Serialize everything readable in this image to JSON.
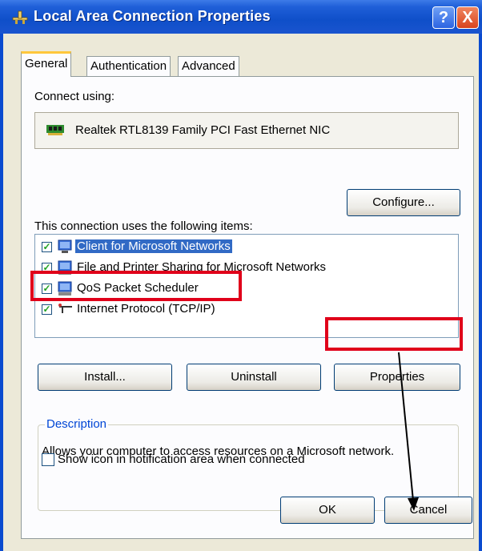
{
  "window": {
    "title": "Local Area Connection Properties",
    "help_glyph": "?",
    "close_glyph": "X"
  },
  "tabs": [
    {
      "label": "General",
      "selected": true
    },
    {
      "label": "Authentication",
      "selected": false
    },
    {
      "label": "Advanced",
      "selected": false
    }
  ],
  "general": {
    "connect_using_label": "Connect using:",
    "adapter_name": "Realtek RTL8139 Family PCI Fast Ethernet NIC",
    "configure_label": "Configure...",
    "items_label": "This connection uses the following items:",
    "items": [
      {
        "label": "Client for Microsoft Networks",
        "checked": true,
        "selected": true,
        "icon": "network-client-icon"
      },
      {
        "label": "File and Printer Sharing for Microsoft Networks",
        "checked": true,
        "selected": false,
        "icon": "computer-icon"
      },
      {
        "label": "QoS Packet Scheduler",
        "checked": true,
        "selected": false,
        "icon": "computer-icon"
      },
      {
        "label": "Internet Protocol (TCP/IP)",
        "checked": true,
        "selected": false,
        "icon": "protocol-icon"
      }
    ],
    "install_label": "Install...",
    "uninstall_label": "Uninstall",
    "properties_label": "Properties",
    "description_legend": "Description",
    "description_text": "Allows your computer to access resources on a Microsoft network.",
    "show_icon_label": "Show icon in notification area when connected",
    "show_icon_checked": false
  },
  "footer": {
    "ok_label": "OK",
    "cancel_label": "Cancel"
  },
  "annotation_colors": {
    "highlight": "#e0001a",
    "arrow": "#000000"
  }
}
